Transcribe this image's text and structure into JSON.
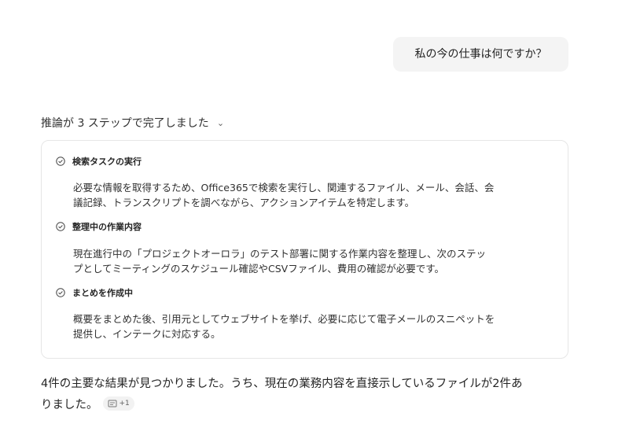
{
  "conversation": {
    "user_message": "私の今の仕事は何ですか？",
    "reasoning": {
      "summary": "推論が 3 ステップで完了しました",
      "steps": [
        {
          "title": "検索タスクの実行",
          "lines": [
            "必要な情報を取得するため、Office365で検索を実行し、関連するファイル、メール、会話、会",
            "議記録、トランスクリプトを調べながら、アクションアイテムを特定します。"
          ]
        },
        {
          "title": "整理中の作業内容",
          "lines": [
            "現在進行中の「プロジェクトオーロラ」のテスト部署に関する作業内容を整理し、次のステッ",
            "プとしてミーティングのスケジュール確認やCSVファイル、費用の確認が必要です。"
          ]
        },
        {
          "title": "まとめを作成中",
          "lines": [
            "概要をまとめた後、引用元としてウェブサイトを挙げ、必要に応じて電子メールのスニペットを",
            "提供し、インテークに対応する。"
          ]
        }
      ]
    },
    "response": {
      "line1": "4件の主要な結果が見つかりました。うち、現在の業務内容を直接示しているファイルが2件あ",
      "line2": "りました。",
      "citation_more": "+1"
    }
  },
  "icons": {
    "step_status": "check-circle-icon",
    "toggle": "chevron-down-icon",
    "citation": "document-icon"
  }
}
